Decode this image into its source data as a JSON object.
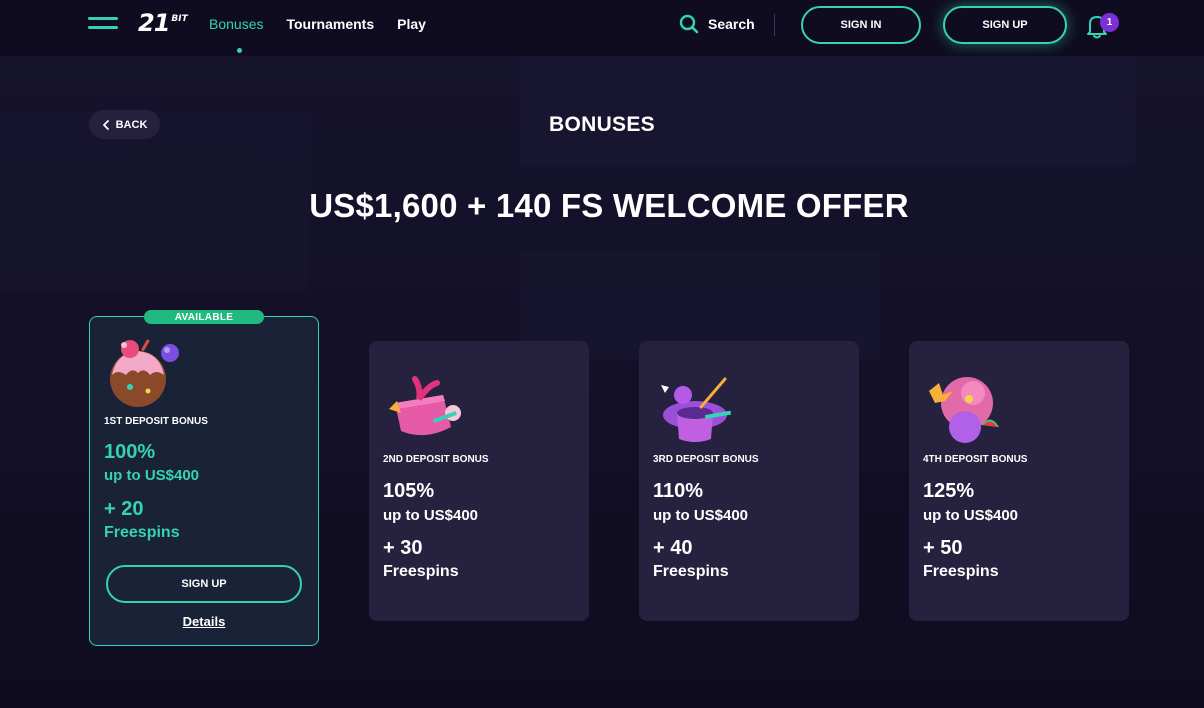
{
  "header": {
    "logo_main": "21",
    "logo_small": "BIT",
    "nav": [
      {
        "label": "Bonuses",
        "active": true
      },
      {
        "label": "Tournaments",
        "active": false
      },
      {
        "label": "Play",
        "active": false
      }
    ],
    "search_label": "Search",
    "signin_label": "SIGN IN",
    "signup_label": "SIGN UP",
    "notification_count": "1"
  },
  "page": {
    "back_label": "BACK",
    "title": "BONUSES",
    "offer": "US$1,600 + 140 FS WELCOME OFFER"
  },
  "cards": [
    {
      "badge": "AVAILABLE",
      "label": "1ST DEPOSIT BONUS",
      "percent": "100%",
      "upto": "up to US$400",
      "freespins": "+ 20",
      "freespins_label": "Freespins",
      "signup_label": "SIGN UP",
      "details_label": "Details",
      "icon": "donut-icon"
    },
    {
      "label": "2ND DEPOSIT BONUS",
      "percent": "105%",
      "upto": "up to US$400",
      "freespins": "+ 30",
      "freespins_label": "Freespins",
      "icon": "gift-cake-icon"
    },
    {
      "label": "3RD DEPOSIT BONUS",
      "percent": "110%",
      "upto": "up to US$400",
      "freespins": "+ 40",
      "freespins_label": "Freespins",
      "icon": "magic-hat-icon"
    },
    {
      "label": "4TH DEPOSIT BONUS",
      "percent": "125%",
      "upto": "up to US$400",
      "freespins": "+ 50",
      "freespins_label": "Freespins",
      "icon": "candy-icon"
    }
  ],
  "colors": {
    "accent": "#35d2b4",
    "background": "#120f26",
    "card": "#25213f",
    "badge": "#20b97f",
    "notification": "#7b2fd6"
  }
}
